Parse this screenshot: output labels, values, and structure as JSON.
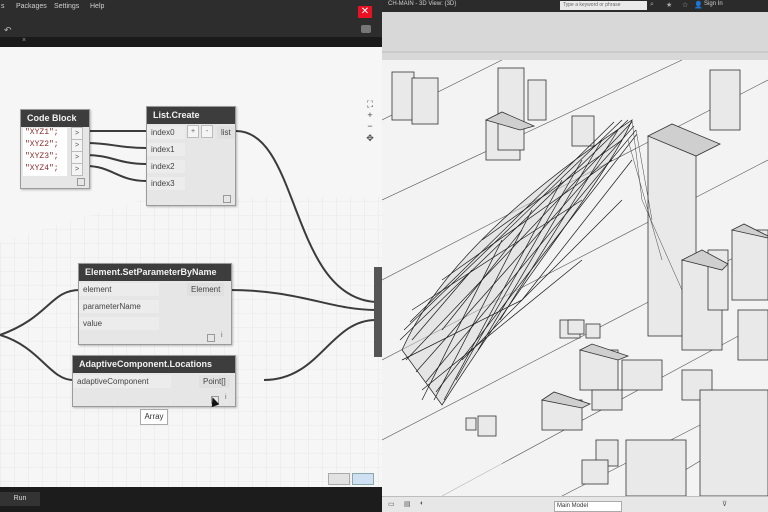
{
  "dynamo": {
    "menus": [
      "Packages",
      "Settings",
      "Help"
    ],
    "nodes": {
      "code_block": {
        "title": "Code Block",
        "lines": [
          "\"XYZ1\";",
          "\"XYZ2\";",
          "\"XYZ3\";",
          "\"XYZ4\";"
        ],
        "out_port": ">"
      },
      "list_create": {
        "title": "List.Create",
        "inputs": [
          "index0",
          "index1",
          "index2",
          "index3"
        ],
        "plus": "+",
        "minus": "-",
        "output": "list"
      },
      "set_param": {
        "title": "Element.SetParameterByName",
        "inputs": [
          "element",
          "parameterName",
          "value"
        ],
        "output": "Element"
      },
      "adaptive": {
        "title": "AdaptiveComponent.Locations",
        "inputs": [
          "adaptiveComponent"
        ],
        "output": "Point[]"
      }
    },
    "tooltip": "Array",
    "run_label": "Run"
  },
  "revit": {
    "title": "CH-MAIN - 3D View: {3D}",
    "search_placeholder": "Type a keyword or phrase",
    "sign_in": "Sign In",
    "model_select": "Main Model"
  }
}
